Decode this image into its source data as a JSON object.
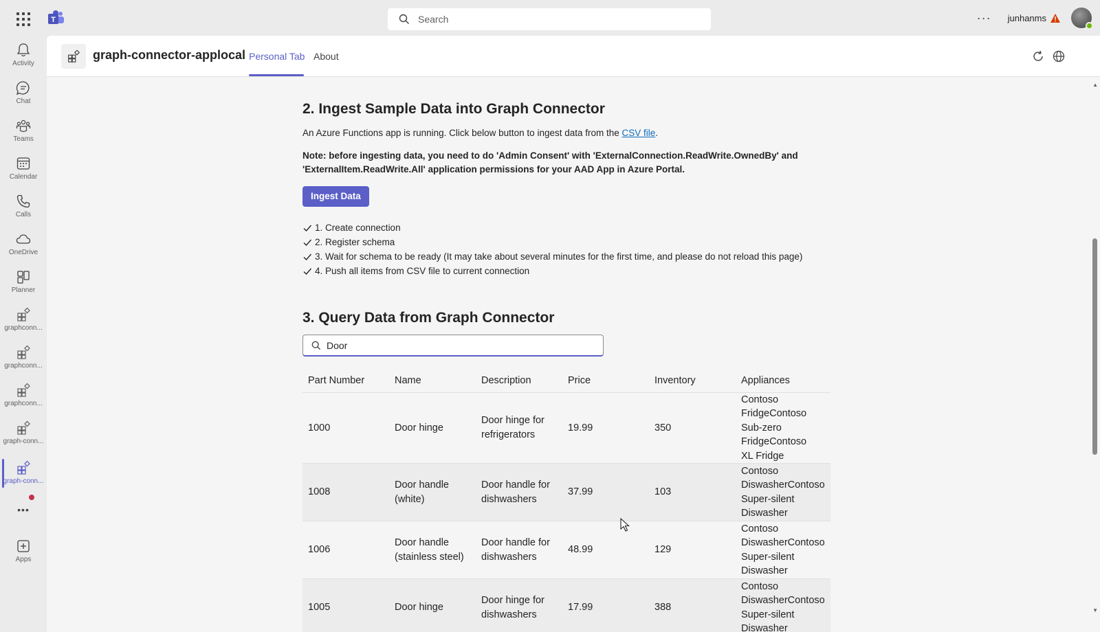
{
  "topbar": {
    "search_placeholder": "Search",
    "more_label": "···",
    "username": "junhanms"
  },
  "rail": {
    "items": [
      {
        "label": "Activity",
        "icon": "bell-icon"
      },
      {
        "label": "Chat",
        "icon": "chat-icon"
      },
      {
        "label": "Teams",
        "icon": "teams-icon"
      },
      {
        "label": "Calendar",
        "icon": "calendar-icon"
      },
      {
        "label": "Calls",
        "icon": "phone-icon"
      },
      {
        "label": "OneDrive",
        "icon": "cloud-icon"
      },
      {
        "label": "Planner",
        "icon": "planner-icon"
      },
      {
        "label": "graphconn...",
        "icon": "app-icon"
      },
      {
        "label": "graphconn...",
        "icon": "app-icon"
      },
      {
        "label": "graphconn...",
        "icon": "app-icon"
      },
      {
        "label": "graph-conn...",
        "icon": "app-icon"
      },
      {
        "label": "graph-conn...",
        "icon": "app-icon"
      }
    ],
    "more": "•••",
    "apps_label": "Apps"
  },
  "app": {
    "title": "graph-connector-applocal",
    "tabs": [
      "Personal Tab",
      "About"
    ],
    "active_tab": "Personal Tab",
    "accent": "#5b5fc7"
  },
  "section2": {
    "heading": "2. Ingest Sample Data into Graph Connector",
    "intro_prefix": "An Azure Functions app is running. Click below button to ingest data from the ",
    "intro_link": "CSV file",
    "intro_suffix": ".",
    "note_line1": "Note: before ingesting data, you need to do 'Admin Consent' with 'ExternalConnection.ReadWrite.OwnedBy' and",
    "note_line2": "'ExternalItem.ReadWrite.All' application permissions for your AAD App in Azure Portal.",
    "button": "Ingest Data",
    "steps": [
      "1. Create connection",
      "2. Register schema",
      "3. Wait for schema to be ready (It may take about several minutes for the first time, and please do not reload this page)",
      "4. Push all items from CSV file to current connection"
    ]
  },
  "section3": {
    "heading": "3. Query Data from Graph Connector",
    "search_value": "Door",
    "columns": [
      "Part Number",
      "Name",
      "Description",
      "Price",
      "Inventory",
      "Appliances"
    ],
    "rows": [
      {
        "part": "1000",
        "name": "Door hinge",
        "desc": "Door hinge for\nrefrigerators",
        "price": "19.99",
        "inventory": "350",
        "appliances": "Contoso\nFridgeContoso\nSub-zero\nFridgeContoso\nXL Fridge"
      },
      {
        "part": "1008",
        "name": "Door handle\n(white)",
        "desc": "Door handle for\ndishwashers",
        "price": "37.99",
        "inventory": "103",
        "appliances": "Contoso\nDiswasherContoso\nSuper-silent\nDiswasher"
      },
      {
        "part": "1006",
        "name": "Door handle\n(stainless steel)",
        "desc": "Door handle for\ndishwashers",
        "price": "48.99",
        "inventory": "129",
        "appliances": "Contoso\nDiswasherContoso\nSuper-silent\nDiswasher"
      },
      {
        "part": "1005",
        "name": "Door hinge",
        "desc": "Door hinge for\ndishwashers",
        "price": "17.99",
        "inventory": "388",
        "appliances": "Contoso\nDiswasherContoso\nSuper-silent\nDiswasher"
      }
    ]
  }
}
